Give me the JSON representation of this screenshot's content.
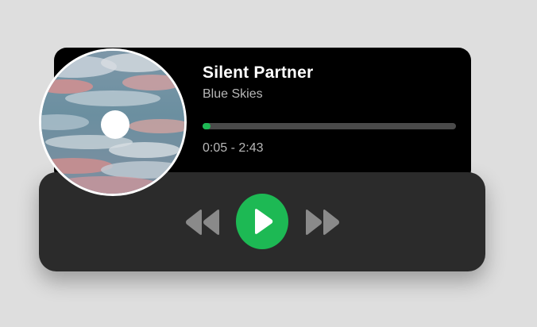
{
  "track": {
    "title": "Silent Partner",
    "artist": "Blue Skies"
  },
  "playback": {
    "time_display": "0:05 - 2:43",
    "progress_fraction": 0.031
  },
  "controls": {
    "rewind_icon": "rewind-icon",
    "play_icon": "play-icon",
    "forward_icon": "fast-forward-icon"
  },
  "colors": {
    "accent": "#1db954",
    "card_top": "#000000",
    "card_bottom": "#2b2b2b",
    "control_icon": "#8a8a8a",
    "background": "#dedede"
  }
}
